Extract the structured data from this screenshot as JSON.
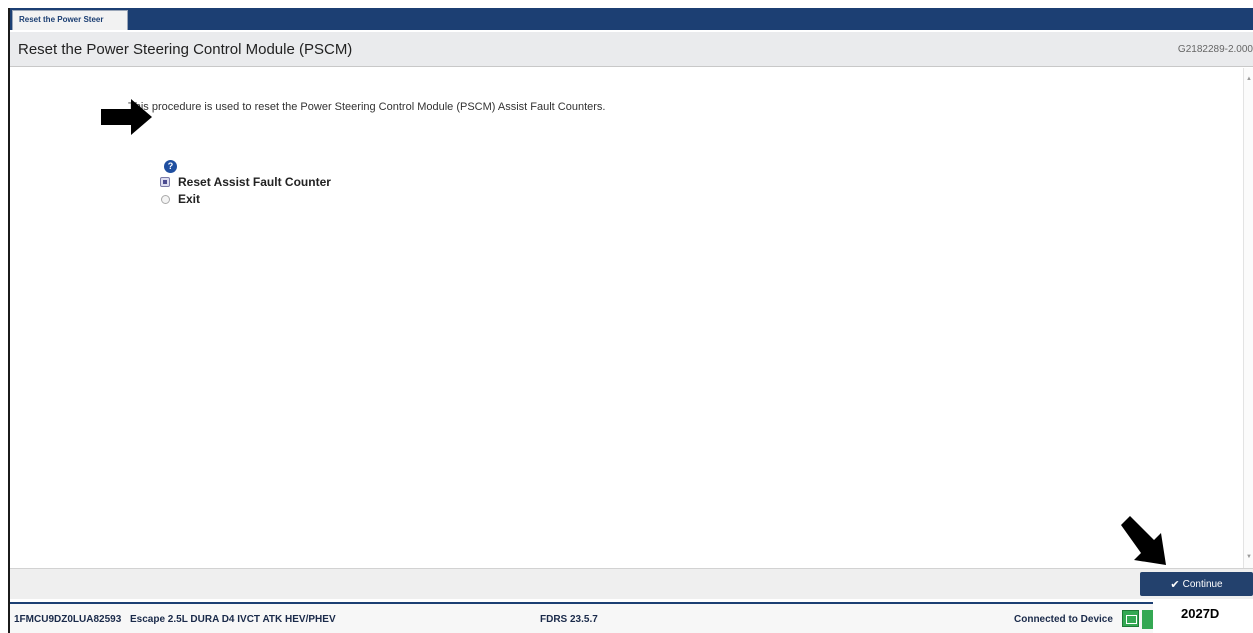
{
  "tab": {
    "label": "Reset the Power Steer"
  },
  "header": {
    "title": "Reset the Power Steering Control Module (PSCM)",
    "id": "G2182289-2.000"
  },
  "content": {
    "description": "This procedure is used to reset the Power Steering Control Module (PSCM) Assist Fault Counters.",
    "options": [
      {
        "label": "Reset Assist Fault Counter",
        "selected": true
      },
      {
        "label": "Exit",
        "selected": false
      }
    ]
  },
  "footer": {
    "continue_label": "Continue"
  },
  "status": {
    "vin": "1FMCU9DZ0LUA82593",
    "vehicle": "Escape 2.5L DURA D4 IVCT ATK HEV/PHEV",
    "version": "FDRS 23.5.7",
    "connection": "Connected to Device"
  },
  "figure_code": "2027D",
  "colors": {
    "accent": "#1c3f73",
    "button": "#23416d",
    "status_ok": "#34a853"
  },
  "icons": [
    "help-icon",
    "check-icon",
    "device-icon",
    "signal-icon",
    "arrow-icon"
  ]
}
